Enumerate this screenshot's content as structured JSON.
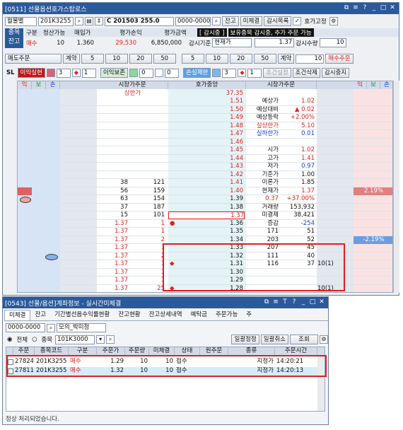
{
  "main": {
    "title": "[0511] 선물옵션호가스탑로스",
    "toolbar": {
      "account_type": "월물별",
      "code": "201K3255",
      "contract": "C 201503 255.0",
      "account": "0000-0000",
      "btn_balance": "잔고",
      "btn_unfilled": "미체결",
      "btn_watchlist": "감시목록",
      "chk_fixed": "호가고정"
    },
    "summary": {
      "tab_type": "종목",
      "tab_balance": "잔고",
      "h_side": "구분",
      "h_qty": "청산가능",
      "h_avg": "매입가",
      "h_pnl": "평가손익",
      "h_eval": "평가금액",
      "side": "매수",
      "qty": "10",
      "avg": "1.360",
      "pnl": "29,530",
      "eval": "6,850,000",
      "watch_btn": "[ 감시중 ]",
      "watch_note": "보유종목 감시중, 추가 주문 가능",
      "price_basis_label": "감시기준",
      "price_basis": "현재가",
      "price_value": "1.37",
      "qty_label": "감시수량",
      "qty_value": "10"
    },
    "order_row": {
      "sell_order": "매도주문",
      "qty_btn": "계약",
      "presets": [
        "5",
        "10",
        "20",
        "50"
      ],
      "qty_btn2": "계약",
      "qty_value": "10",
      "buy_order": "매수주문"
    },
    "sl_row": {
      "sl": "SL",
      "take_profit": "이익실현",
      "tp_ticks": "3",
      "tp_count": "1",
      "trailing": "이익보존",
      "tr_ticks": "0",
      "tr_count": "0",
      "stop_loss": "손실제한",
      "sl_ticks": "3",
      "sl_count": "1",
      "cond_set": "조건설정",
      "cond_delete": "조건삭제",
      "stop_watch": "감시중지"
    },
    "grid": {
      "h_left": [
        "익",
        "보",
        "손"
      ],
      "h_mkt_sell": "시장가주문",
      "h_center": "호가중앙",
      "h_mkt_buy": "시장가주문",
      "h_right": [
        "익",
        "보",
        "손"
      ],
      "upper_limit_label": "상한가",
      "upper_limit": "37.35",
      "prices": [
        "1.51",
        "1.50",
        "1.49",
        "1.48",
        "1.47",
        "1.46",
        "1.45",
        "1.44",
        "1.43",
        "1.42",
        "1.41",
        "1.40",
        "1.39",
        "1.38",
        "1.37",
        "1.36",
        "1.35",
        "1.34",
        "1.33",
        "1.32",
        "1.31",
        "1.30",
        "1.29",
        "1.28"
      ],
      "sell_depth": [
        {
          "i": 11,
          "cnt": "38",
          "qty": "121"
        },
        {
          "i": 12,
          "cnt": "56",
          "qty": "159"
        },
        {
          "i": 13,
          "cnt": "63",
          "qty": "154"
        },
        {
          "i": 14,
          "cnt": "37",
          "qty": "187"
        },
        {
          "i": 15,
          "cnt": "15",
          "qty": "101"
        }
      ],
      "sell_orders": [
        {
          "i": 16,
          "p": "1.37",
          "q": "1"
        },
        {
          "i": 17,
          "p": "1.37",
          "q": "1"
        },
        {
          "i": 18,
          "p": "1.37",
          "q": "2"
        },
        {
          "i": 19,
          "p": "1.37",
          "q": "1"
        },
        {
          "i": 20,
          "p": "1.37",
          "q": "2"
        },
        {
          "i": 21,
          "p": "1.37",
          "q": "1"
        },
        {
          "i": 22,
          "p": "1.37",
          "q": "1"
        },
        {
          "i": 23,
          "p": "1.37",
          "q": "1"
        },
        {
          "i": 24,
          "p": "1.37",
          "q": "25"
        }
      ],
      "info": [
        {
          "i": 1,
          "k": "예상가",
          "v": "1.02",
          "c": "red"
        },
        {
          "i": 2,
          "k": "예상대비",
          "v": "▲  0.02",
          "c": "red"
        },
        {
          "i": 3,
          "k": "예상등락",
          "v": "+2.00%",
          "c": "red"
        },
        {
          "i": 4,
          "k": "실상한가",
          "v": "5.10",
          "c": "red",
          "kc": "red"
        },
        {
          "i": 5,
          "k": "실하한가",
          "v": "0.01",
          "c": "blue",
          "kc": "blue"
        },
        {
          "i": 7,
          "k": "시가",
          "v": "1.02",
          "c": "red"
        },
        {
          "i": 8,
          "k": "고가",
          "v": "1.41",
          "c": "red"
        },
        {
          "i": 9,
          "k": "저가",
          "v": "0.97",
          "c": "blue"
        },
        {
          "i": 10,
          "k": "기준가",
          "v": "1.00",
          "c": ""
        },
        {
          "i": 11,
          "k": "이론가",
          "v": "1.85",
          "c": ""
        },
        {
          "i": 12,
          "k": "현재가",
          "v": "1.37",
          "c": "red"
        },
        {
          "i": 13,
          "k": "0.37",
          "v": "+37.00%",
          "c": "red",
          "kc": "red"
        },
        {
          "i": 14,
          "k": "거래량",
          "v": "153,932",
          "c": ""
        },
        {
          "i": 15,
          "k": "미결제",
          "v": "38,421",
          "c": ""
        },
        {
          "i": 16,
          "k": "증감",
          "v": "-254",
          "c": "blue"
        }
      ],
      "buy_depth": [
        {
          "i": 17,
          "cnt": "171",
          "qty": "51"
        },
        {
          "i": 18,
          "cnt": "203",
          "qty": "52"
        },
        {
          "i": 19,
          "cnt": "207",
          "qty": "45"
        },
        {
          "i": 20,
          "cnt": "111",
          "qty": "40"
        },
        {
          "i": 21,
          "cnt": "116",
          "qty": "37"
        }
      ],
      "my_orders": [
        {
          "i": 21,
          "v": "10(1)"
        },
        {
          "i": 24,
          "v": "10(1)"
        }
      ],
      "pct_up": "2.19%",
      "pct_down": "-2.19%"
    }
  },
  "sub": {
    "title": "[0543] 선물/옵션]계좌정보 - 실시간미체결",
    "tabs": [
      "미체결",
      "잔고",
      "기간별선옵수익률현황",
      "잔고현황",
      "잔고상세내역",
      "예탁금",
      "주문가능",
      "주"
    ],
    "account": "0000-0000",
    "account_name": "모의_박미정",
    "radio_all": "전체",
    "radio_item": "종목",
    "code": "101K3000",
    "btn_bulk_modify": "일괄정정",
    "btn_bulk_cancel": "일괄취소",
    "btn_query": "조회",
    "headers": [
      "주문",
      "종목코드",
      "구분",
      "주문가",
      "주문량",
      "미체결",
      "상태",
      "원주문",
      "종류",
      "주문시간"
    ],
    "rows": [
      [
        "27824",
        "201K3255",
        "매수",
        "1.29",
        "10",
        "10",
        "접수",
        "",
        "지정가",
        "14:20:21"
      ],
      [
        "27811",
        "201K3255",
        "매수",
        "1.32",
        "10",
        "10",
        "접수",
        "",
        "지정가",
        "14:20:13"
      ]
    ],
    "status": "정상 처리되었습니다."
  }
}
